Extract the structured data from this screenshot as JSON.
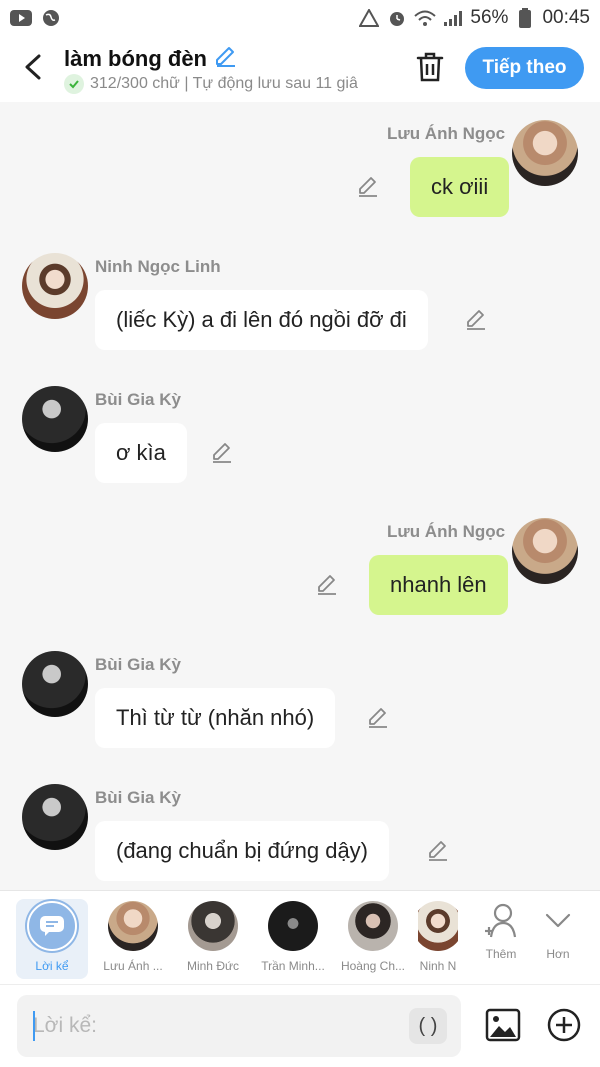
{
  "status_bar": {
    "battery_pct": "56%",
    "time": "00:45"
  },
  "header": {
    "title": "làm bóng đèn",
    "subtitle": "312/300 chữ | Tự động lưu sau 11 giâ",
    "next_label": "Tiếp theo"
  },
  "messages": [
    {
      "sender": "Lưu Ánh Ngọc",
      "text": "ck ơiii",
      "side": "right"
    },
    {
      "sender": "Ninh Ngọc Linh",
      "text": "(liếc Kỳ) a đi lên đó ngồi đỡ đi",
      "side": "left"
    },
    {
      "sender": "Bùi Gia Kỳ",
      "text": "ơ kìa",
      "side": "left"
    },
    {
      "sender": "Lưu Ánh Ngọc",
      "text": "nhanh lên",
      "side": "right"
    },
    {
      "sender": "Bùi Gia Kỳ",
      "text": "Thì từ từ (nhăn nhó)",
      "side": "left"
    },
    {
      "sender": "Bùi Gia Kỳ",
      "text": "(đang chuẩn bị đứng dậy)",
      "side": "left"
    }
  ],
  "character_bar": {
    "narrator_label": "Lời kể",
    "characters": [
      {
        "label": "Lưu Ánh ..."
      },
      {
        "label": "Minh Đức"
      },
      {
        "label": "Trần Minh..."
      },
      {
        "label": "Hoàng Ch..."
      },
      {
        "label": "Ninh N"
      }
    ],
    "add_label": "Thêm",
    "more_label": "Hơn"
  },
  "input": {
    "placeholder": "Lời kể:",
    "paren_label": "( )"
  },
  "colors": {
    "accent": "#3f9af2",
    "bubble_right": "#d5f58e",
    "bubble_left": "#ffffff"
  }
}
